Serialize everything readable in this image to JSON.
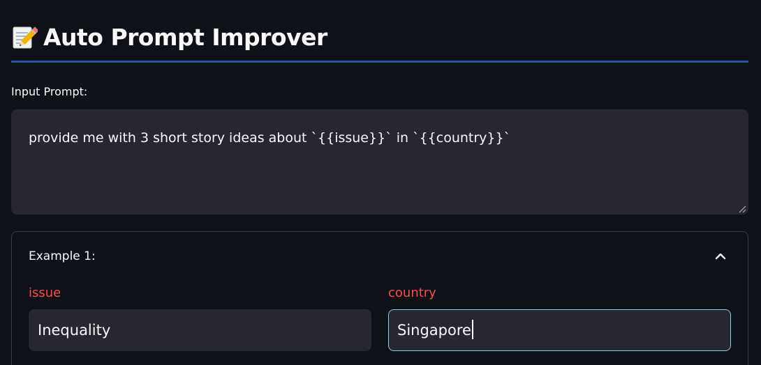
{
  "header": {
    "title": "Auto Prompt Improver",
    "icon": "memo-icon"
  },
  "prompt": {
    "label": "Input Prompt:",
    "value": "provide me with 3 short story ideas about `{{issue}}` in `{{country}}`"
  },
  "example": {
    "title": "Example 1:",
    "expanded": true,
    "fields": [
      {
        "label": "issue",
        "value": "Inequality"
      },
      {
        "label": "country",
        "value": "Singapore"
      }
    ]
  },
  "colors": {
    "background": "#0e1117",
    "divider": "#1c57a4",
    "field_label": "#ff4b4b",
    "input_bg": "#262730",
    "focus_border": "#8ecbe6"
  }
}
